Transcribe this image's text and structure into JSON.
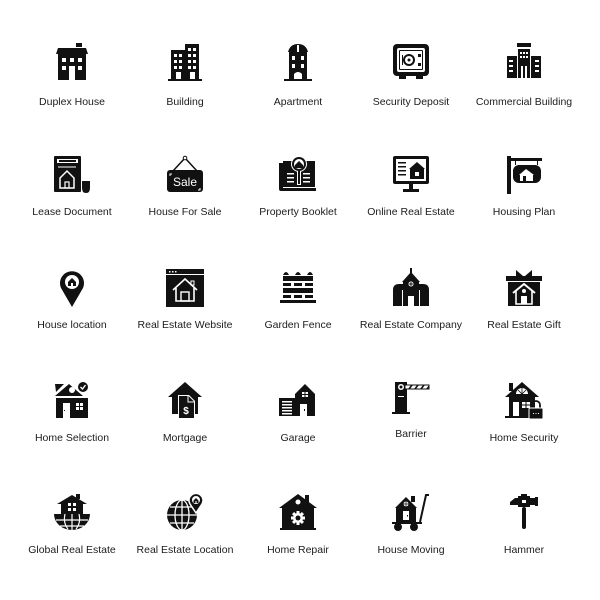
{
  "icons": [
    {
      "label": "Duplex House",
      "icon": "duplex-house-icon"
    },
    {
      "label": "Building",
      "icon": "building-icon"
    },
    {
      "label": "Apartment",
      "icon": "apartment-icon"
    },
    {
      "label": "Security Deposit",
      "icon": "safe-icon"
    },
    {
      "label": "Commercial Building",
      "icon": "commercial-building-icon"
    },
    {
      "label": "Lease Document",
      "icon": "lease-document-icon"
    },
    {
      "label": "House For Sale",
      "icon": "sale-sign-icon"
    },
    {
      "label": "Property Booklet",
      "icon": "property-booklet-icon"
    },
    {
      "label": "Online Real Estate",
      "icon": "monitor-house-icon"
    },
    {
      "label": "Housing Plan",
      "icon": "hanging-sign-icon"
    },
    {
      "label": "House location",
      "icon": "location-pin-house-icon"
    },
    {
      "label": "Real Estate Website",
      "icon": "browser-house-icon"
    },
    {
      "label": "Garden Fence",
      "icon": "fence-icon"
    },
    {
      "label": "Real Estate Company",
      "icon": "company-building-icon"
    },
    {
      "label": "Real Estate Gift",
      "icon": "gift-house-icon"
    },
    {
      "label": "Home Selection",
      "icon": "home-selection-icon"
    },
    {
      "label": "Mortgage",
      "icon": "mortgage-icon"
    },
    {
      "label": "Garage",
      "icon": "garage-icon"
    },
    {
      "label": "Barrier",
      "icon": "barrier-icon"
    },
    {
      "label": "Home Security",
      "icon": "home-lock-icon"
    },
    {
      "label": "Global Real Estate",
      "icon": "globe-house-icon"
    },
    {
      "label": "Real Estate Location",
      "icon": "globe-pin-icon"
    },
    {
      "label": "Home Repair",
      "icon": "house-gear-icon"
    },
    {
      "label": "House Moving",
      "icon": "house-cart-icon"
    },
    {
      "label": "Hammer",
      "icon": "hammer-icon"
    }
  ]
}
